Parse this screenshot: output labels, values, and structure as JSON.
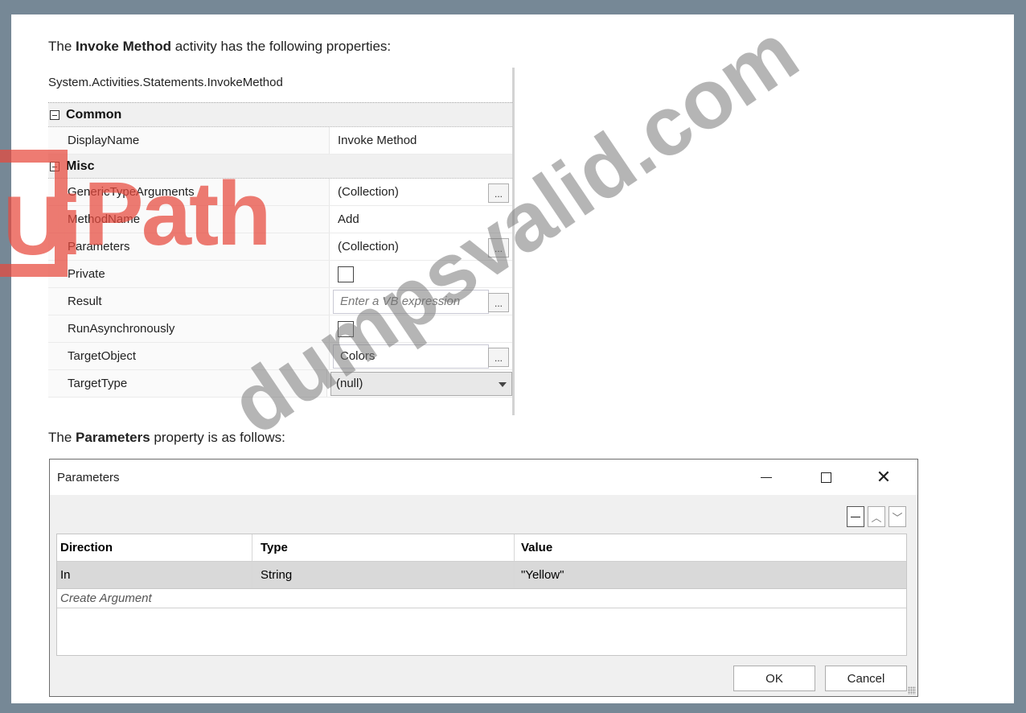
{
  "intro": {
    "prefix": "The ",
    "bold": "Invoke Method",
    "suffix": " activity has the following properties:"
  },
  "property_grid": {
    "type_name": "System.Activities.Statements.InvokeMethod",
    "categories": {
      "common": "Common",
      "misc": "Misc"
    },
    "common_rows": [
      {
        "name": "DisplayName",
        "value": "Invoke Method"
      }
    ],
    "misc_rows": [
      {
        "name": "GenericTypeArguments",
        "value": "(Collection)"
      },
      {
        "name": "MethodName",
        "value": "Add"
      },
      {
        "name": "Parameters",
        "value": "(Collection)"
      },
      {
        "name": "Private",
        "value": ""
      },
      {
        "name": "Result",
        "placeholder": "Enter a VB expression"
      },
      {
        "name": "RunAsynchronously",
        "value": ""
      },
      {
        "name": "TargetObject",
        "value": "Colors"
      },
      {
        "name": "TargetType",
        "value": "(null)"
      }
    ],
    "ellipsis": "..."
  },
  "watermark": {
    "logo_ui": "Ui",
    "logo_path": "Path",
    "site": "dumpsvalid.com"
  },
  "intro2": {
    "prefix": "The ",
    "bold": "Parameters",
    "suffix": " property is as follows:"
  },
  "dialog": {
    "title": "Parameters",
    "columns": [
      "Direction",
      "Type",
      "Value"
    ],
    "rows": [
      {
        "direction": "In",
        "type": "String",
        "value": "\"Yellow\""
      }
    ],
    "create_argument": "Create Argument",
    "ok_label": "OK",
    "cancel_label": "Cancel",
    "close_glyph": "✕"
  }
}
